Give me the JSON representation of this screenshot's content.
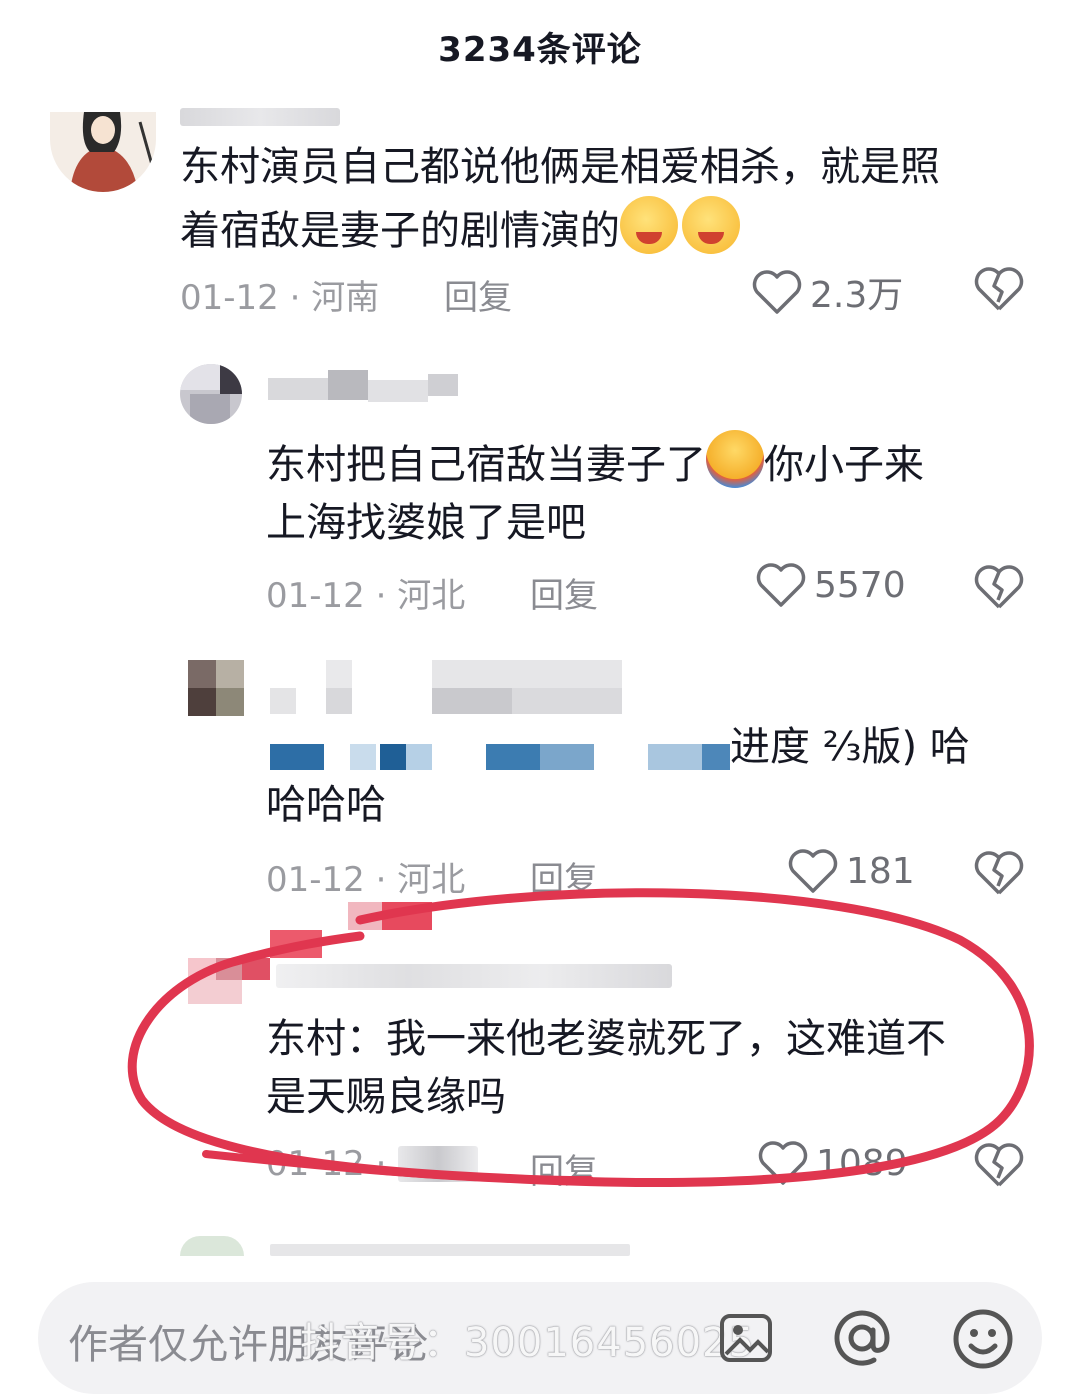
{
  "header": {
    "title": "3234条评论"
  },
  "comments": [
    {
      "text": "东村演员自己都说他俩是相爱相杀，就是照着宿敌是妻子的剧情演的",
      "line1": "东村演员自己都说他俩是相爱相杀，就是照",
      "line2": "着宿敌是妻子的剧情演的",
      "meta": "01-12 · 河南",
      "reply_label": "回复",
      "likes": "2.3万"
    },
    {
      "line1a": "东村把自己宿敌当妻子了",
      "line1b": "你小子来",
      "line2": "上海找婆娘了是吧",
      "meta": "01-12 · 河北",
      "reply_label": "回复",
      "likes": "5570"
    },
    {
      "line1_visible": "进度 ⅔版) 哈",
      "line2": "哈哈哈",
      "meta": "01-12 · 河北",
      "reply_label": "回复",
      "likes": "181"
    },
    {
      "line1": "东村：我一来他老婆就死了，这难道不",
      "line2": "是天赐良缘吗",
      "meta": "01-12 ·",
      "reply_label": "回复",
      "likes": "1089"
    }
  ],
  "input": {
    "placeholder": "作者仅允许朋友评论"
  },
  "watermark": "抖音号：30016456025",
  "colors": {
    "annotation": "#e0364f",
    "text": "#161823",
    "meta": "#9a9ba0"
  }
}
